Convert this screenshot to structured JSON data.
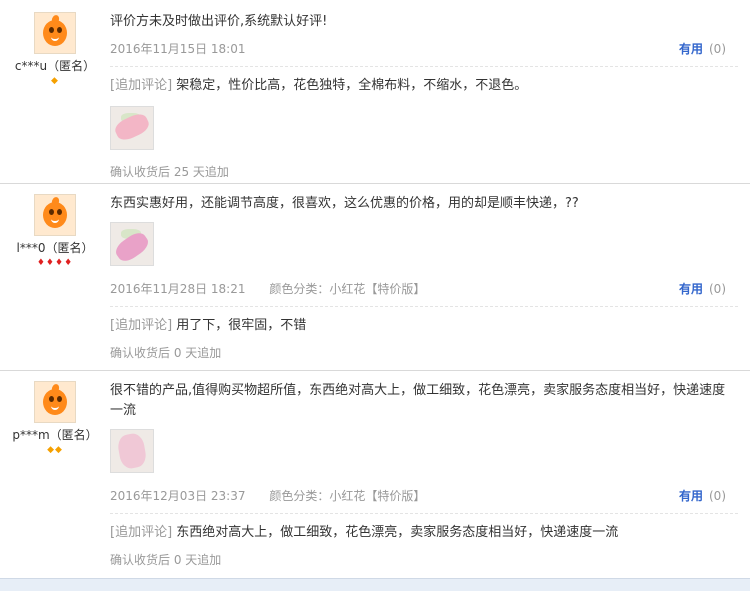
{
  "reviews": [
    {
      "user": "c***u（匿名）",
      "badge_icons": "◆",
      "text": "评价方未及时做出评价,系统默认好评!",
      "date": "2016年11月15日 18:01",
      "variant": "",
      "useful_label": "有用",
      "useful_count": "(0)",
      "append_tag": "[追加评论]",
      "append_text": "架稳定，性价比高，花色独特，全棉布料，不缩水，不退色。",
      "confirm": "确认收货后 25 天追加"
    },
    {
      "user": "l***0（匿名）",
      "badge_icons": "♦♦♦♦",
      "text": "东西实惠好用，还能调节高度，很喜欢，这么优惠的价格，用的却是顺丰快递，??",
      "date": "2016年11月28日 18:21",
      "variant": "颜色分类：小红花【特价版】",
      "useful_label": "有用",
      "useful_count": "(0)",
      "append_tag": "[追加评论]",
      "append_text": "用了下，很牢固，不错",
      "confirm": "确认收货后 0 天追加"
    },
    {
      "user": "p***m（匿名）",
      "badge_icons": "◆◆",
      "text": "很不错的产品,值得购买物超所值，东西绝对高大上，做工细致，花色漂亮，卖家服务态度相当好，快递速度一流",
      "date": "2016年12月03日 23:37",
      "variant": "颜色分类：小红花【特价版】",
      "useful_label": "有用",
      "useful_count": "(0)",
      "append_tag": "[追加评论]",
      "append_text": "东西绝对高大上，做工细致，花色漂亮，卖家服务态度相当好，快递速度一流",
      "confirm": "确认收货后 0 天追加"
    }
  ]
}
